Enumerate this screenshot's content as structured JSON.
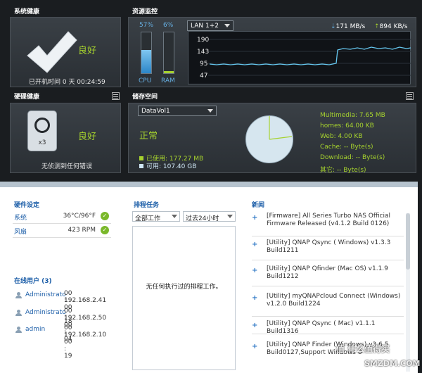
{
  "system_health": {
    "title": "系统健康",
    "status": "良好",
    "uptime": "已开机时间 0 天 00:24:59"
  },
  "disk_health": {
    "title": "硬碟健康",
    "status": "良好",
    "disk_count": "x3",
    "message": "无侦测到任何错误"
  },
  "resource": {
    "title": "资源监控",
    "cpu_percent": "57%",
    "cpu_label": "CPU",
    "cpu_value": 0.57,
    "ram_percent": "6%",
    "ram_label": "RAM",
    "ram_value": 0.06,
    "lan_select": "LAN 1+2",
    "download_speed": "171 MB/s",
    "upload_speed": "894 KB/s",
    "y_ticks": [
      "190",
      "143",
      "95",
      "47"
    ]
  },
  "storage": {
    "title": "储存空间",
    "volume_select": "DataVol1",
    "status": "正常",
    "used": "已使用: 177.27 MB",
    "free": "可用: 107.40 GB",
    "breakdown": [
      "Multimedia: 7.65 MB",
      "homes: 64.00 KB",
      "Web: 4.00 KB",
      "Cache: -- Byte(s)",
      "Download: -- Byte(s)",
      "其它: -- Byte(s)"
    ]
  },
  "hardware": {
    "title": "硬件设定",
    "rows": [
      {
        "label": "系统",
        "value": "36°C/96°F"
      },
      {
        "label": "风扇",
        "value": "423 RPM"
      }
    ]
  },
  "online_users": {
    "title": "在线用户 (3)",
    "users": [
      {
        "name": "Administrato",
        "time": "00 : 00 : 18",
        "ip": "192.168.2.41"
      },
      {
        "name": "Administrato",
        "time": "00 : 00 : 04",
        "ip": "192.168.2.50"
      },
      {
        "name": "admin",
        "time": "00 : 00 : 19",
        "ip": "192.168.2.10"
      }
    ]
  },
  "scheduled_tasks": {
    "title": "排程任务",
    "filter_type": "全部工作",
    "filter_range": "过去24小时",
    "empty_text": "无任何执行过的排程工作。"
  },
  "news": {
    "title": "新闻",
    "items": [
      "[Firmware] All Series Turbo NAS Official Firmware Released (v4.1.2 Build 0126)",
      "[Utility] QNAP Qsync ( Windows) v1.3.3 Build1211",
      "[Utility] QNAP Qfinder (Mac OS) v1.1.9 Build1212",
      "[Utility] myQNAPcloud Connect (Windows) v1.2.0 Build1224",
      "[Utility] QNAP Qsync ( Mac) v1.1.1 Build1316",
      "[Utility] QNAP Finder (Windows) v3.6.5 Build0127,Support Windows 8"
    ]
  },
  "watermark": {
    "line1": "值 什么值得买",
    "line2": "SMZDM.COM"
  },
  "colors": {
    "accent_green": "#a6d22e",
    "accent_blue": "#66aee0",
    "link_blue": "#1c5ea8"
  }
}
